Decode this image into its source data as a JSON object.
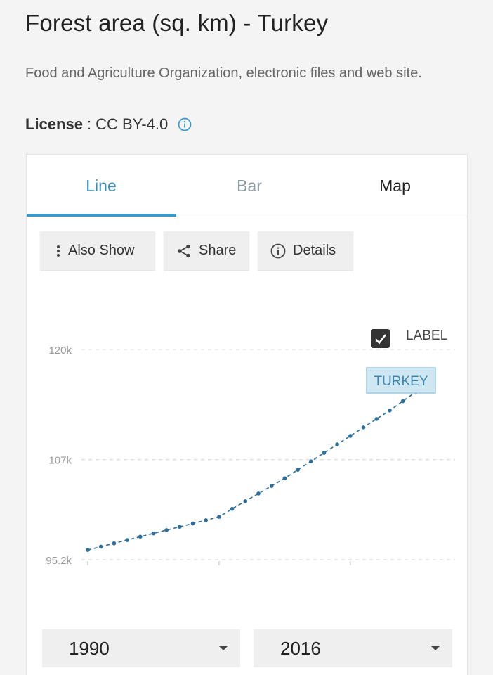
{
  "header": {
    "title": "Forest area (sq. km) - Turkey",
    "source": "Food and Agriculture Organization, electronic files and web site.",
    "license_label": "License",
    "license_sep": ":",
    "license_value": "CC BY-4.0"
  },
  "tabs": [
    {
      "label": "Line",
      "active": true
    },
    {
      "label": "Bar",
      "active": false
    },
    {
      "label": "Map",
      "active": false
    }
  ],
  "toolbar": {
    "also_show": "Also Show",
    "share": "Share",
    "details": "Details"
  },
  "label_toggle": {
    "label": "LABEL",
    "checked": true
  },
  "range": {
    "start": "1990",
    "end": "2016"
  },
  "colors": {
    "accent": "#3d8fb5",
    "series": "#2f6f99",
    "label_bg": "#cfe7f3"
  },
  "icons": {
    "info": "info-circle-icon",
    "also_show": "vertical-dots-icon",
    "share": "share-icon",
    "details": "info-circle-icon",
    "dropdown": "caret-down-icon",
    "checkbox": "check-icon"
  },
  "chart_data": {
    "type": "line",
    "title": "",
    "xlabel": "",
    "ylabel": "",
    "y_ticks": [
      {
        "value": 95200,
        "label": "95.2k"
      },
      {
        "value": 107000,
        "label": "107k"
      },
      {
        "value": 120000,
        "label": "120k"
      }
    ],
    "ylim": [
      95200,
      120000
    ],
    "xlim": [
      1990,
      2016
    ],
    "x_ticks": [
      1990,
      2000,
      2010
    ],
    "grid": true,
    "series": [
      {
        "name": "TURKEY",
        "x": [
          1990,
          1991,
          1992,
          1993,
          1994,
          1995,
          1996,
          1997,
          1998,
          1999,
          2000,
          2001,
          2002,
          2003,
          2004,
          2005,
          2006,
          2007,
          2008,
          2009,
          2010,
          2011,
          2012,
          2013,
          2014,
          2015,
          2016
        ],
        "values": [
          96350,
          96740,
          97130,
          97520,
          97910,
          98300,
          98690,
          99080,
          99470,
          99860,
          100250,
          101200,
          102100,
          103000,
          103900,
          104800,
          105800,
          106800,
          107800,
          108800,
          109800,
          110800,
          111800,
          112800,
          113900,
          115000,
          117200
        ]
      }
    ],
    "series_label": "TURKEY"
  }
}
